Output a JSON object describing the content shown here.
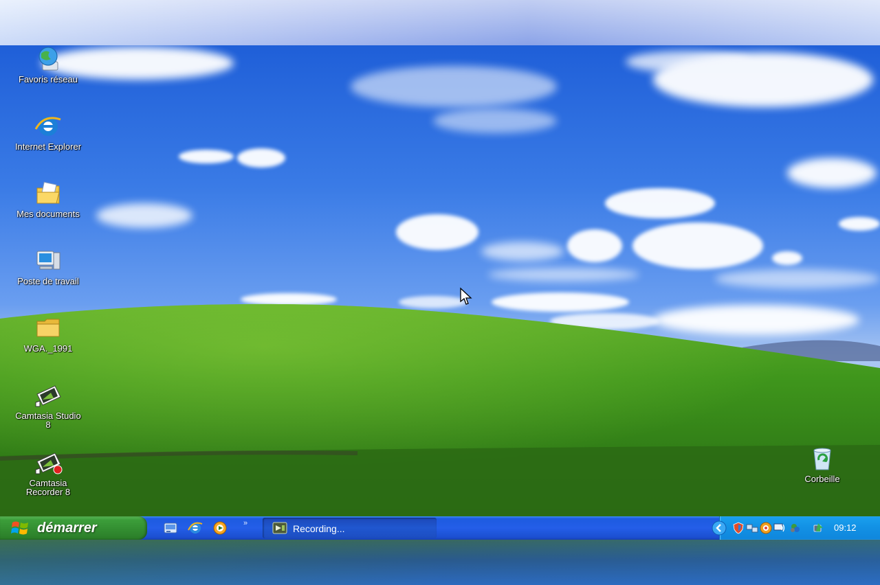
{
  "desktop_icons": [
    {
      "name": "favoris-reseau",
      "label": "Favoris réseau",
      "icon": "network-globe-icon"
    },
    {
      "name": "internet-explorer",
      "label": "Internet Explorer",
      "icon": "internet-explorer-icon"
    },
    {
      "name": "mes-documents",
      "label": "Mes documents",
      "icon": "documents-folder-icon"
    },
    {
      "name": "poste-de-travail",
      "label": "Poste de travail",
      "icon": "computer-icon"
    },
    {
      "name": "wga-1991",
      "label": "WGA._1991",
      "icon": "folder-icon"
    },
    {
      "name": "camtasia-studio",
      "label": "Camtasia Studio\n8",
      "icon": "camtasia-studio-icon"
    },
    {
      "name": "camtasia-recorder",
      "label": "Camtasia\nRecorder 8",
      "icon": "camtasia-recorder-icon"
    },
    {
      "name": "corbeille",
      "label": "Corbeille",
      "icon": "recycle-bin-icon"
    }
  ],
  "taskbar": {
    "start_label": "démarrer",
    "quick_launch": [
      "show-desktop-icon",
      "internet-explorer-icon",
      "media-player-icon"
    ],
    "quick_launch_more": "»",
    "tasks": [
      {
        "label": "Recording...",
        "icon": "camtasia-recording-icon"
      }
    ],
    "tray_icons": [
      "show-hidden-icons-chevron",
      "volume-icon",
      "security-icon",
      "network-icon",
      "messenger-icon",
      "safely-remove-icon"
    ],
    "clock": "09:12"
  },
  "colors": {
    "sky": "#2f6fe0",
    "grass": "#3f8f1f",
    "taskbar": "#245ee8",
    "start_button": "#328c30",
    "tray": "#1393e6"
  }
}
